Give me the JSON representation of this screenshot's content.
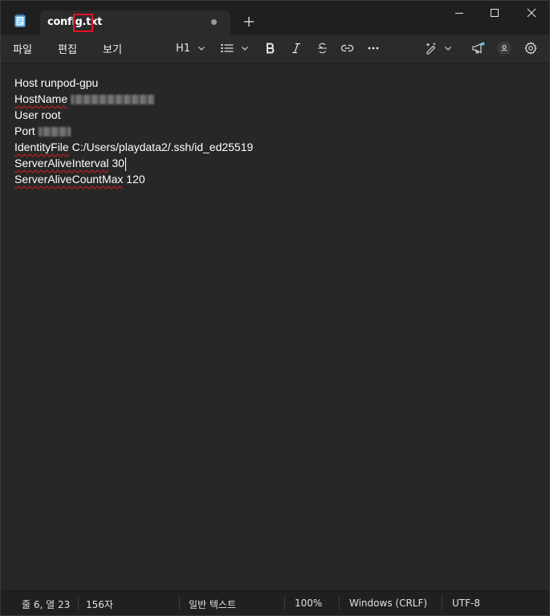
{
  "tab": {
    "name": "config",
    "ext": ".txt"
  },
  "menu": [
    "파일",
    "편집",
    "보기"
  ],
  "toolbar": {
    "heading": "H1"
  },
  "editor": {
    "lines": [
      {
        "key": "Host",
        "value": "runpod-gpu"
      },
      {
        "key": "HostName",
        "value": ""
      },
      {
        "key": "User",
        "value": "root"
      },
      {
        "key": "Port",
        "value": ""
      },
      {
        "key": "IdentityFile",
        "value": "C:/Users/playdata2/.ssh/id_ed25519"
      },
      {
        "key": "ServerAliveInterval",
        "value": "30"
      },
      {
        "key": "ServerAliveCountMax",
        "value": "120"
      }
    ]
  },
  "status": {
    "position": "줄 6, 열 23",
    "chars": "156자",
    "mode": "일반 텍스트",
    "zoom": "100%",
    "eol": "Windows (CRLF)",
    "encoding": "UTF-8"
  }
}
